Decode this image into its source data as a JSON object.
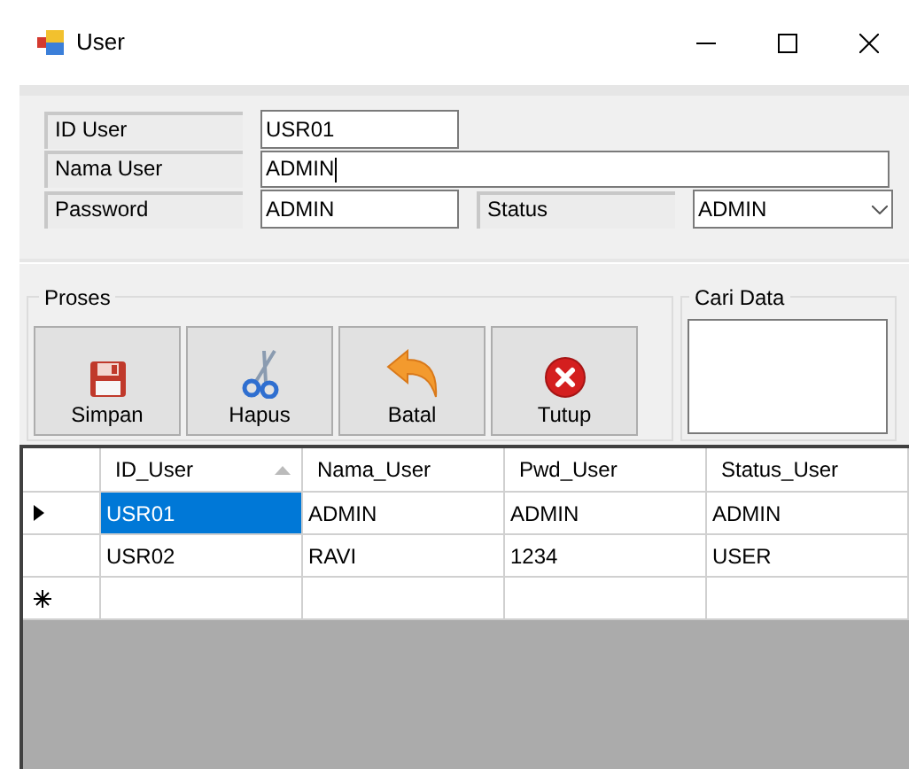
{
  "window": {
    "title": "User"
  },
  "form": {
    "id_label": "ID User",
    "id_value": "USR01",
    "name_label": "Nama User",
    "name_value": "ADMIN",
    "name_focused": true,
    "password_label": "Password",
    "password_value": "ADMIN",
    "status_label": "Status",
    "status_value": "ADMIN"
  },
  "proses": {
    "title": "Proses",
    "buttons": [
      "Simpan",
      "Hapus",
      "Batal",
      "Tutup"
    ]
  },
  "search": {
    "title": "Cari Data"
  },
  "table": {
    "columns": [
      {
        "label": "ID_User",
        "sorted": true
      },
      {
        "label": "Nama_User",
        "sorted": false
      },
      {
        "label": "Pwd_User",
        "sorted": false
      },
      {
        "label": "Status_User",
        "sorted": false
      }
    ],
    "rows": [
      {
        "kind": "current",
        "cells": [
          {
            "text": "USR01",
            "selected": true
          },
          {
            "text": "ADMIN",
            "selected": false
          },
          {
            "text": "ADMIN",
            "selected": false
          },
          {
            "text": "ADMIN",
            "selected": false
          }
        ]
      },
      {
        "kind": "plain",
        "cells": [
          {
            "text": "USR02",
            "selected": false
          },
          {
            "text": "RAVI",
            "selected": false
          },
          {
            "text": "1234",
            "selected": false
          },
          {
            "text": "USER",
            "selected": false
          }
        ]
      },
      {
        "kind": "new"
      }
    ]
  }
}
